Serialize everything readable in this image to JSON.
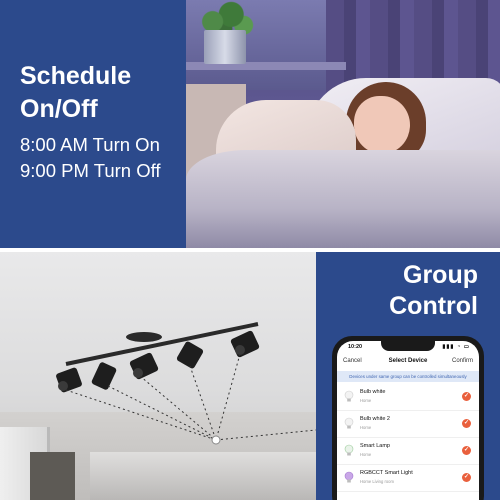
{
  "schedule": {
    "title": "Schedule\nOn/Off",
    "on_line": "8:00 AM Turn On",
    "off_line": "9:00 PM Turn Off"
  },
  "group": {
    "title": "Group\nControl"
  },
  "phone": {
    "status_time": "10:20",
    "status_icons": "▮▮▮ ◔ ▭",
    "header": {
      "cancel": "Cancel",
      "title": "Select Device",
      "confirm": "Confirm"
    },
    "notice": "Devices under same group can be controlled simultaneously",
    "devices": [
      {
        "name": "Bulb white",
        "room": "Home",
        "icon": "bulb-icon",
        "checked": true
      },
      {
        "name": "Bulb white 2",
        "room": "Home",
        "icon": "bulb-icon",
        "checked": true
      },
      {
        "name": "Smart Lamp",
        "room": "Home",
        "icon": "bulb-icon",
        "checked": true
      },
      {
        "name": "RGBCCT Smart Light",
        "room": "Home Living room",
        "icon": "color-bulb-icon",
        "checked": true
      }
    ]
  },
  "colors": {
    "panel_blue": "#2c4a8c",
    "check_orange": "#e9603d",
    "notice_text": "#3e64b0"
  }
}
